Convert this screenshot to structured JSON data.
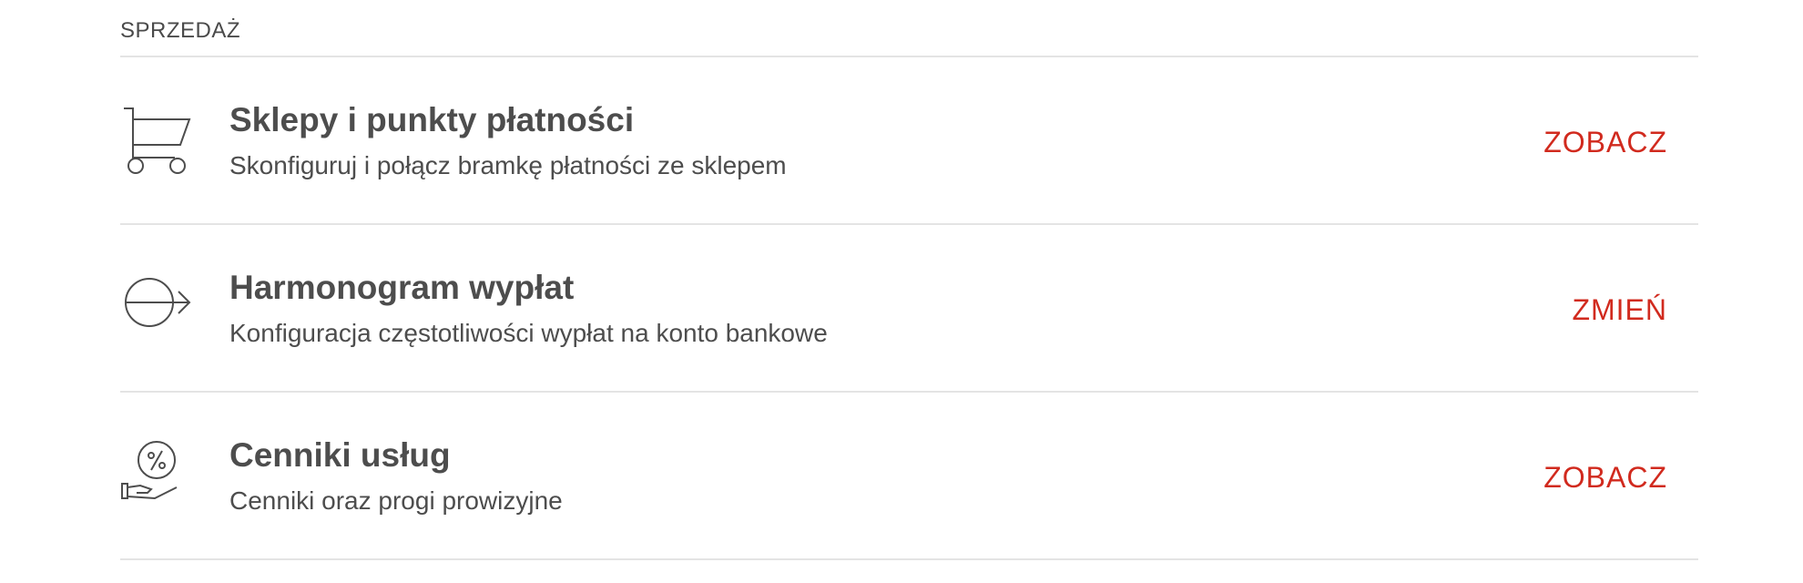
{
  "section": {
    "title": "SPRZEDAŻ"
  },
  "rows": [
    {
      "icon": "cart-icon",
      "title": "Sklepy i punkty płatności",
      "subtitle": "Skonfiguruj i połącz bramkę płatności ze sklepem",
      "action": "ZOBACZ"
    },
    {
      "icon": "payout-arrow-icon",
      "title": "Harmonogram wypłat",
      "subtitle": "Konfiguracja częstotliwości wypłat na konto bankowe",
      "action": "ZMIEŃ"
    },
    {
      "icon": "percent-hand-icon",
      "title": "Cenniki usług",
      "subtitle": "Cenniki oraz progi prowizyjne",
      "action": "ZOBACZ"
    }
  ],
  "colors": {
    "accent": "#d12a1e",
    "text": "#4d4d4d",
    "divider": "#e4e4e4"
  }
}
